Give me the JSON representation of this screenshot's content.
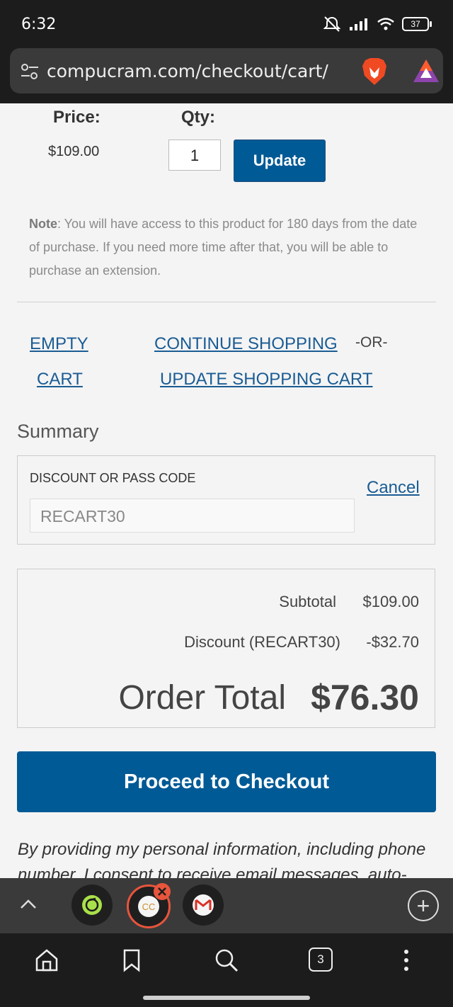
{
  "status_bar": {
    "time": "6:32",
    "battery": "37"
  },
  "browser": {
    "url": "compucram.com/checkout/cart/",
    "tab_count": "3"
  },
  "cart": {
    "price_label": "Price:",
    "qty_label": "Qty:",
    "price_value": "$109.00",
    "qty_value": "1",
    "update_label": "Update",
    "note_label": "Note",
    "note_text": ": You will have access to this product for 180 days from the date of purchase. If you need more time after that, you will be able to purchase an extension.",
    "empty_cart_line1": "EMPTY",
    "empty_cart_line2": "CART",
    "continue_shopping": "CONTINUE SHOPPING",
    "or_text": "-OR-",
    "update_shopping_cart": "UPDATE SHOPPING CART"
  },
  "summary": {
    "title": "Summary",
    "discount_label": "DISCOUNT OR PASS CODE",
    "discount_value": "RECART30",
    "cancel_label": "Cancel",
    "subtotal_label": "Subtotal",
    "subtotal_value": "$109.00",
    "discount_line_label": "Discount (RECART30)",
    "discount_line_value": "-$32.70",
    "order_total_label": "Order Total",
    "order_total_value": "$76.30",
    "checkout_label": "Proceed to Checkout",
    "consent_text": "By providing my personal information, including phone number, I consent to receive email messages, auto-"
  },
  "icons": {
    "url_settings": "tune-icon",
    "brave": "brave-lion-icon",
    "rewards": "brave-rewards-icon",
    "tab_collapse": "chevron-up-icon",
    "tab1": "green-app-icon",
    "tab2": "compucram-favicon-icon",
    "tab3": "gmail-icon",
    "new_tab": "plus-icon",
    "home": "home-icon",
    "bookmark": "bookmark-icon",
    "search": "search-icon",
    "tabs": "tabs-icon",
    "menu": "more-vertical-icon"
  },
  "colors": {
    "primary": "#005a96",
    "link": "#1a5c94",
    "close_badge": "#e8553c"
  }
}
